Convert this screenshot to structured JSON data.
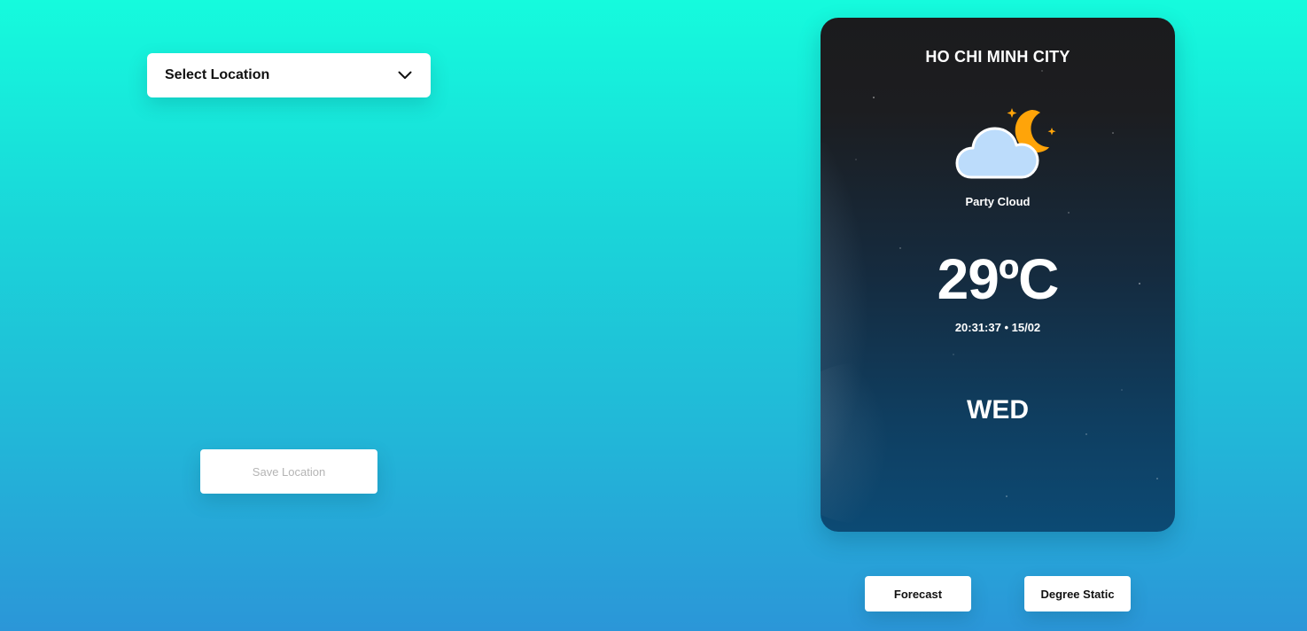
{
  "location_select": {
    "selected": "Select Location",
    "icon": "chevron-down-icon"
  },
  "save_button": {
    "label": "Save Location"
  },
  "weather_card": {
    "city": "HO CHI MINH CITY",
    "icon": "partly-cloudy-night-icon",
    "condition": "Party Cloud",
    "temperature": "29ºC",
    "datetime": "20:31:37 • 15/02",
    "day": "WED"
  },
  "actions": {
    "forecast_label": "Forecast",
    "degree_label": "Degree Static"
  },
  "colors": {
    "background_top": "#15fbdd",
    "background_bottom": "#2b96d8",
    "card_top": "#1b1b1d",
    "card_bottom": "#0c4a74",
    "moon": "#ffa409",
    "cloud": "#bcdcfb"
  }
}
